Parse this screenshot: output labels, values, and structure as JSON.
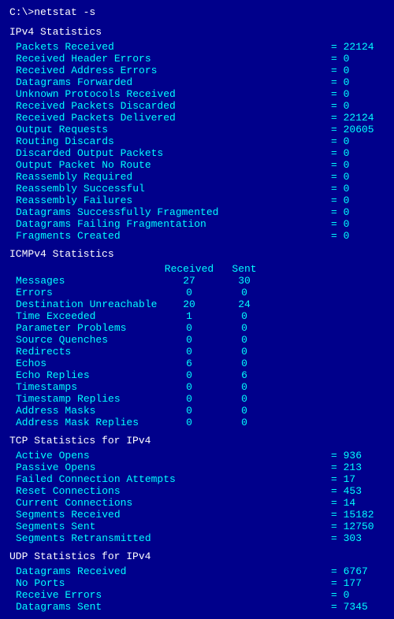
{
  "cmd": "C:\\>netstat -s",
  "ipv4": {
    "header": "IPv4 Statistics",
    "stats": [
      {
        "label": "Packets Received",
        "value": "= 22124"
      },
      {
        "label": "Received Header Errors",
        "value": "= 0"
      },
      {
        "label": "Received Address Errors",
        "value": "= 0"
      },
      {
        "label": "Datagrams Forwarded",
        "value": "= 0"
      },
      {
        "label": "Unknown Protocols Received",
        "value": "= 0"
      },
      {
        "label": "Received Packets Discarded",
        "value": "= 0"
      },
      {
        "label": "Received Packets Delivered",
        "value": "= 22124"
      },
      {
        "label": "Output Requests",
        "value": "= 20605"
      },
      {
        "label": "Routing Discards",
        "value": "= 0"
      },
      {
        "label": "Discarded Output Packets",
        "value": "= 0"
      },
      {
        "label": "Output Packet No Route",
        "value": "= 0"
      },
      {
        "label": "Reassembly Required",
        "value": "= 0"
      },
      {
        "label": "Reassembly Successful",
        "value": "= 0"
      },
      {
        "label": "Reassembly Failures",
        "value": "= 0"
      },
      {
        "label": "Datagrams Successfully Fragmented",
        "value": "= 0"
      },
      {
        "label": "Datagrams Failing Fragmentation",
        "value": "= 0"
      },
      {
        "label": "Fragments Created",
        "value": "= 0"
      }
    ]
  },
  "icmpv4": {
    "header": "ICMPv4 Statistics",
    "col_received": "Received",
    "col_sent": "Sent",
    "rows": [
      {
        "label": "Messages",
        "received": "27",
        "sent": "30"
      },
      {
        "label": "Errors",
        "received": "0",
        "sent": "0"
      },
      {
        "label": "Destination Unreachable",
        "received": "20",
        "sent": "24"
      },
      {
        "label": "Time Exceeded",
        "received": "1",
        "sent": "0"
      },
      {
        "label": "Parameter Problems",
        "received": "0",
        "sent": "0"
      },
      {
        "label": "Source Quenches",
        "received": "0",
        "sent": "0"
      },
      {
        "label": "Redirects",
        "received": "0",
        "sent": "0"
      },
      {
        "label": "Echos",
        "received": "6",
        "sent": "0"
      },
      {
        "label": "Echo Replies",
        "received": "0",
        "sent": "6"
      },
      {
        "label": "Timestamps",
        "received": "0",
        "sent": "0"
      },
      {
        "label": "Timestamp Replies",
        "received": "0",
        "sent": "0"
      },
      {
        "label": "Address Masks",
        "received": "0",
        "sent": "0"
      },
      {
        "label": "Address Mask Replies",
        "received": "0",
        "sent": "0"
      }
    ]
  },
  "tcp": {
    "header": "TCP Statistics for IPv4",
    "stats": [
      {
        "label": "Active Opens",
        "value": "= 936"
      },
      {
        "label": "Passive Opens",
        "value": "= 213"
      },
      {
        "label": "Failed Connection Attempts",
        "value": "= 17"
      },
      {
        "label": "Reset Connections",
        "value": "= 453"
      },
      {
        "label": "Current Connections",
        "value": "= 14"
      },
      {
        "label": "Segments Received",
        "value": "= 15182"
      },
      {
        "label": "Segments Sent",
        "value": "= 12750"
      },
      {
        "label": "Segments Retransmitted",
        "value": "= 303"
      }
    ]
  },
  "udp": {
    "header": "UDP Statistics for IPv4",
    "stats": [
      {
        "label": "Datagrams Received",
        "value": "= 6767"
      },
      {
        "label": "No Ports",
        "value": "= 177"
      },
      {
        "label": "Receive Errors",
        "value": "= 0"
      },
      {
        "label": "Datagrams Sent",
        "value": "= 7345"
      }
    ]
  }
}
